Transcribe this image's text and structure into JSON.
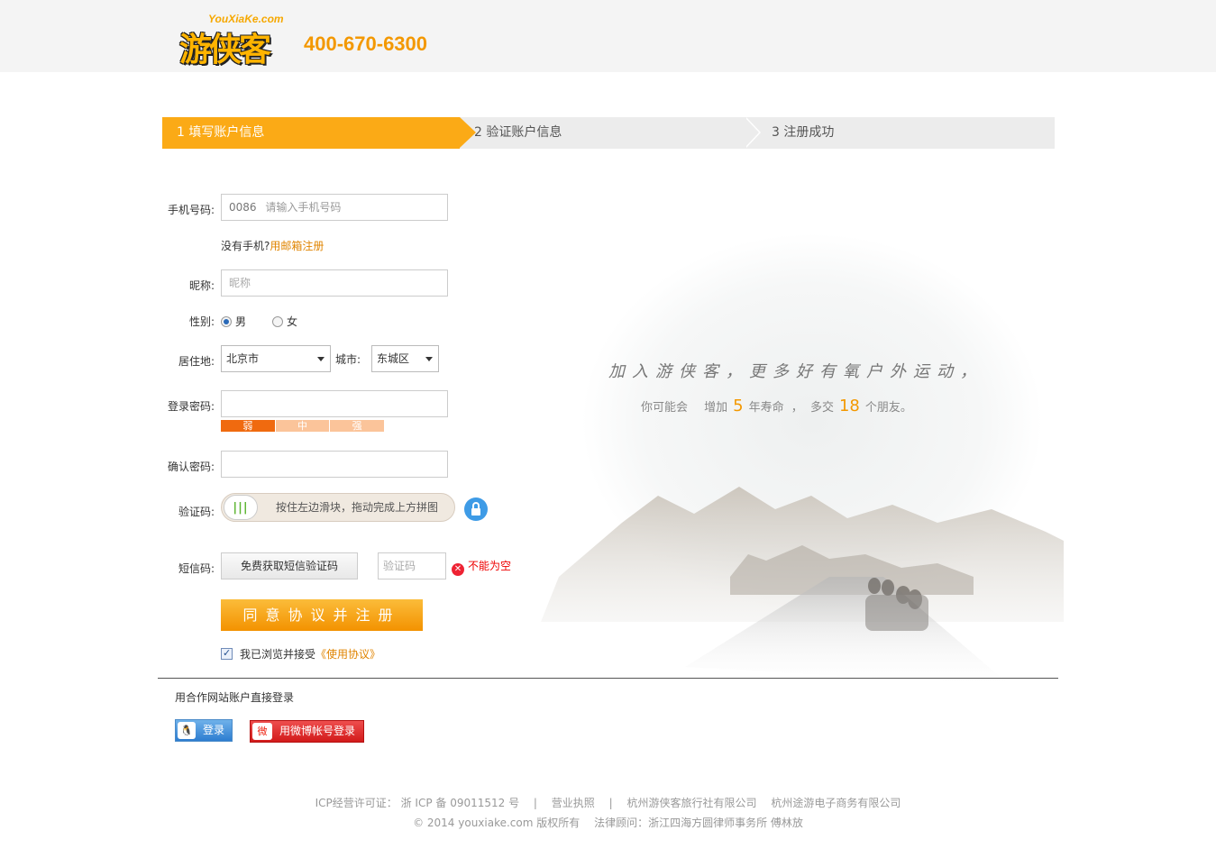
{
  "header": {
    "logo_subtext": "YouXiaKe.com",
    "logo_text": "游侠客",
    "hotline": "400-670-6300"
  },
  "steps": [
    {
      "label": "1 填写账户信息",
      "active": true
    },
    {
      "label": "2 验证账户信息",
      "active": false
    },
    {
      "label": "3 注册成功",
      "active": false
    }
  ],
  "form": {
    "phone_label": "手机号码:",
    "phone_prefix": "0086",
    "phone_placeholder": "请输入手机号码",
    "no_phone_text": "没有手机?",
    "email_register_link": "用邮箱注册",
    "nickname_label": "昵称:",
    "nickname_placeholder": "昵称",
    "gender_label": "性别:",
    "gender_male": "男",
    "gender_female": "女",
    "gender_selected": "男",
    "residence_label": "居住地:",
    "province_value": "北京市",
    "city_label": "城市:",
    "city_value": "东城区",
    "password_label": "登录密码:",
    "strength_weak": "弱",
    "strength_medium": "中",
    "strength_strong": "强",
    "confirm_label": "确认密码:",
    "captcha_label": "验证码:",
    "slider_text": "按住左边滑块，拖动完成上方拼图",
    "sms_label": "短信码:",
    "sms_button": "免费获取短信验证码",
    "sms_placeholder": "验证码",
    "sms_error": "不能为空",
    "submit_button": "同意协议并注册",
    "agree_text": "我已浏览并接受",
    "agree_link": "《使用协议》",
    "agree_checked": true
  },
  "hero": {
    "tagline": "加入游侠客，更多好有氧户外运动，",
    "stat_prefix": "你可能会",
    "stat_increase": "增加",
    "stat_years": "5",
    "stat_years_unit": "年寿命",
    "stat_sep": "，",
    "stat_friends_prefix": "多交",
    "stat_friends": "18",
    "stat_friends_unit": "个朋友。"
  },
  "partner": {
    "title": "用合作网站账户直接登录",
    "qq_button": "登录",
    "weibo_button": "用微博帐号登录"
  },
  "footer": {
    "line1": [
      "ICP经营许可证：  浙 ICP 备 09011512 号",
      "|",
      "营业执照",
      "|",
      "杭州游侠客旅行社有限公司",
      "杭州途游电子商务有限公司"
    ],
    "line2": [
      "© 2014 youxiake.com 版权所有",
      "法律顾问：浙江四海方圆律师事务所  傅林放"
    ]
  },
  "colors": {
    "accent": "#fbaa16",
    "hotline": "#f39800",
    "link": "#e08400",
    "error": "#e00000",
    "step_bg": "#ececec"
  }
}
